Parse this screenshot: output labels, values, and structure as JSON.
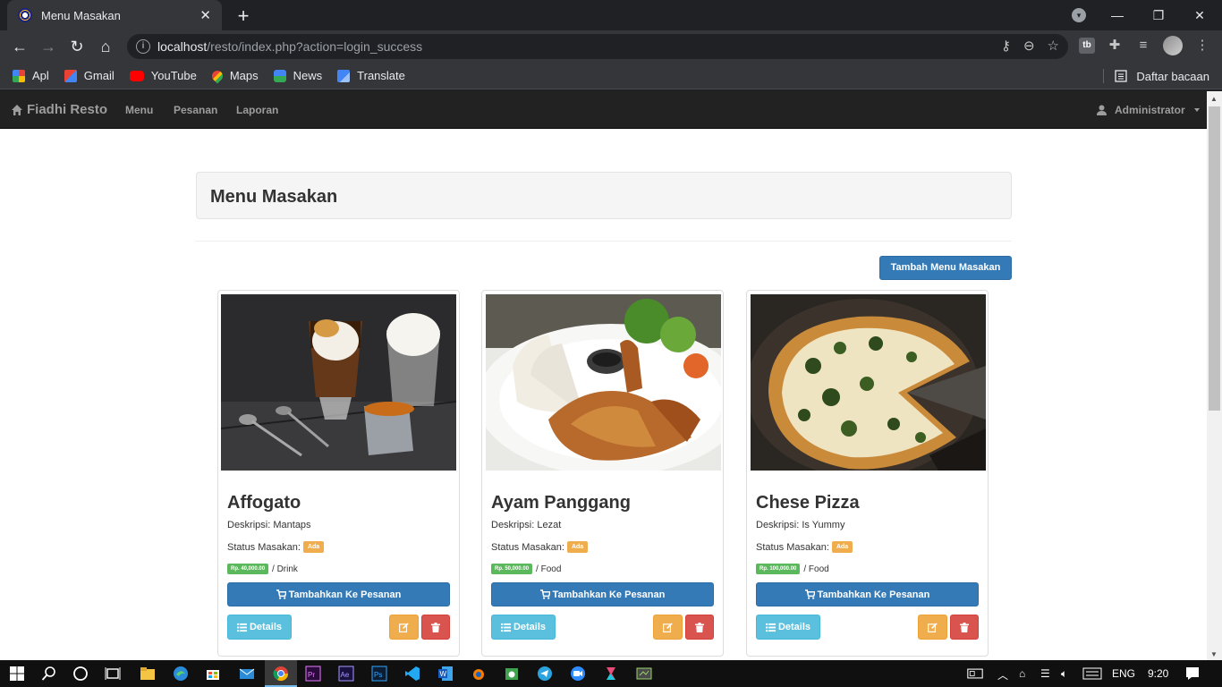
{
  "browser": {
    "tab_title": "Menu Masakan",
    "url_host": "localhost",
    "url_path": "/resto/index.php?action=login_success",
    "bookmarks": [
      {
        "label": "Apl",
        "icon": "apps-grid-icon"
      },
      {
        "label": "Gmail",
        "icon": "gmail-icon"
      },
      {
        "label": "YouTube",
        "icon": "youtube-icon"
      },
      {
        "label": "Maps",
        "icon": "maps-icon"
      },
      {
        "label": "News",
        "icon": "news-icon"
      },
      {
        "label": "Translate",
        "icon": "translate-icon"
      }
    ],
    "reading_list": "Daftar bacaan"
  },
  "navbar": {
    "brand": "Fiadhi Resto",
    "links": [
      "Menu",
      "Pesanan",
      "Laporan"
    ],
    "user": "Administrator"
  },
  "page": {
    "title": "Menu Masakan",
    "add_button": "Tambah Menu Masakan"
  },
  "menu_items": [
    {
      "name": "Affogato",
      "desc_label": "Deskripsi:",
      "desc": "Mantaps",
      "status_label": "Status Masakan:",
      "status": "Ada",
      "price": "Rp. 40,000.00",
      "category": "/ Drink",
      "order_button": "Tambahkan Ke Pesanan",
      "details_button": "Details"
    },
    {
      "name": "Ayam Panggang",
      "desc_label": "Deskripsi:",
      "desc": "Lezat",
      "status_label": "Status Masakan:",
      "status": "Ada",
      "price": "Rp. 50,000.00",
      "category": "/ Food",
      "order_button": "Tambahkan Ke Pesanan",
      "details_button": "Details"
    },
    {
      "name": "Chese Pizza",
      "desc_label": "Deskripsi:",
      "desc": "Is Yummy",
      "status_label": "Status Masakan:",
      "status": "Ada",
      "price": "Rp. 100,000.00",
      "category": "/ Food",
      "order_button": "Tambahkan Ke Pesanan",
      "details_button": "Details"
    }
  ],
  "taskbar": {
    "language": "ENG",
    "time": "9:20"
  },
  "colors": {
    "primary": "#337ab7",
    "info": "#5bc0de",
    "warning": "#f0ad4e",
    "danger": "#d9534f",
    "success": "#5cb85c",
    "navbar": "#222222"
  }
}
